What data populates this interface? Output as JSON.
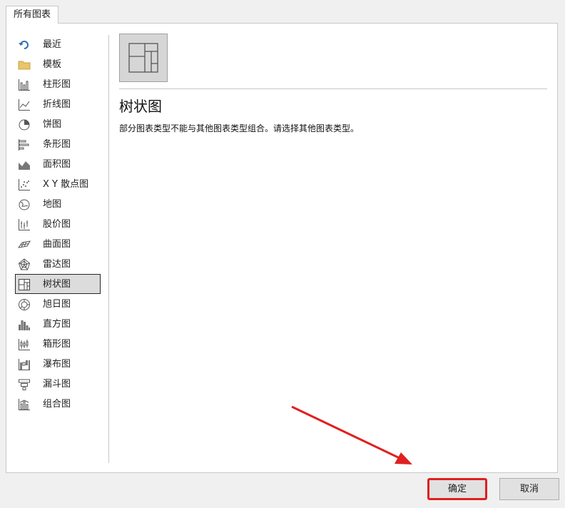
{
  "tab": {
    "label": "所有图表"
  },
  "sidebar": {
    "items": [
      {
        "label": "最近",
        "icon": "undo-arrow-icon"
      },
      {
        "label": "模板",
        "icon": "folder-icon"
      },
      {
        "label": "柱形图",
        "icon": "column-chart-icon"
      },
      {
        "label": "折线图",
        "icon": "line-chart-icon"
      },
      {
        "label": "饼图",
        "icon": "pie-chart-icon"
      },
      {
        "label": "条形图",
        "icon": "bar-chart-icon"
      },
      {
        "label": "面积图",
        "icon": "area-chart-icon"
      },
      {
        "label": "X Y 散点图",
        "icon": "scatter-chart-icon"
      },
      {
        "label": "地图",
        "icon": "globe-icon"
      },
      {
        "label": "股价图",
        "icon": "stock-chart-icon"
      },
      {
        "label": "曲面图",
        "icon": "surface-chart-icon"
      },
      {
        "label": "雷达图",
        "icon": "radar-chart-icon"
      },
      {
        "label": "树状图",
        "icon": "treemap-icon"
      },
      {
        "label": "旭日图",
        "icon": "sunburst-icon"
      },
      {
        "label": "直方图",
        "icon": "histogram-icon"
      },
      {
        "label": "箱形图",
        "icon": "box-whisker-icon"
      },
      {
        "label": "瀑布图",
        "icon": "waterfall-icon"
      },
      {
        "label": "漏斗图",
        "icon": "funnel-icon"
      },
      {
        "label": "组合图",
        "icon": "combo-chart-icon"
      }
    ],
    "selected_index": 12
  },
  "main": {
    "title": "树状图",
    "description": "部分图表类型不能与其他图表类型组合。请选择其他图表类型。"
  },
  "buttons": {
    "ok": "确定",
    "cancel": "取消"
  },
  "colors": {
    "highlight": "#e02020",
    "folder": "#e8c46a",
    "icon_blue": "#2e6db4"
  }
}
